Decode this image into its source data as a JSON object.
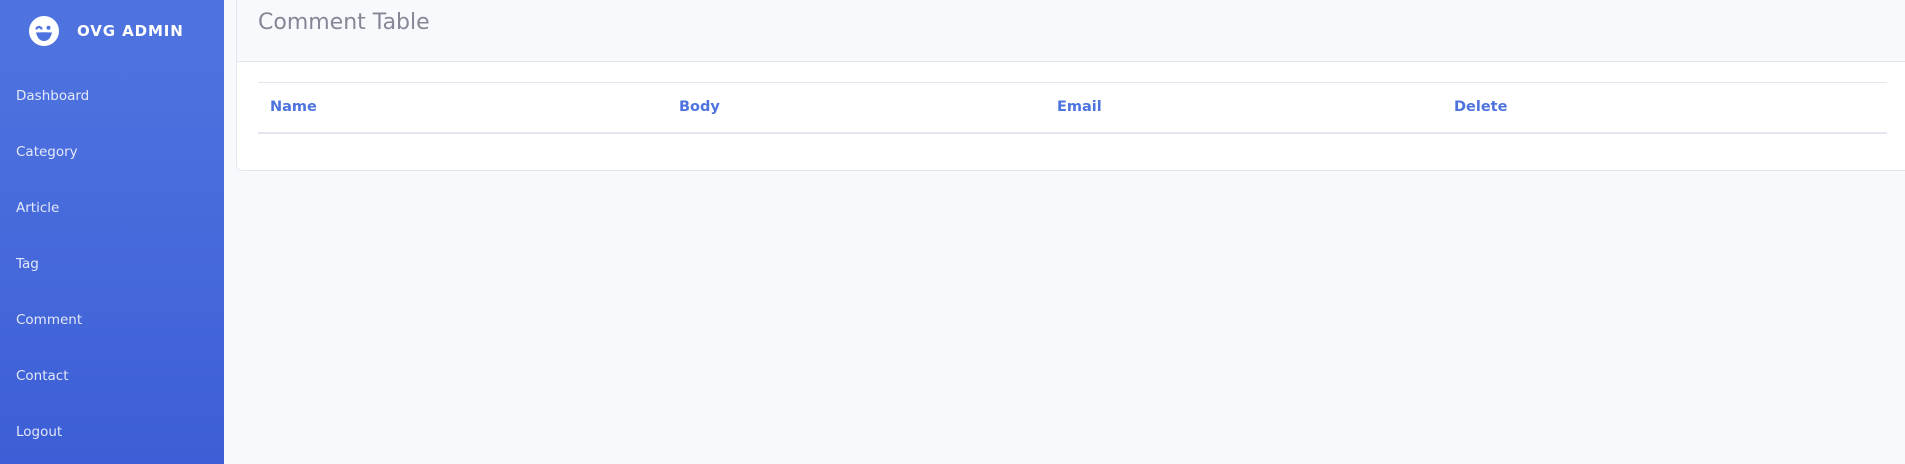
{
  "sidebar": {
    "brand": {
      "icon": "laugh-wink-icon",
      "title": "OVG ADMIN"
    },
    "items": [
      {
        "label": "Dashboard"
      },
      {
        "label": "Category"
      },
      {
        "label": "Article"
      },
      {
        "label": "Tag"
      },
      {
        "label": "Comment"
      },
      {
        "label": "Contact"
      },
      {
        "label": "Logout"
      }
    ]
  },
  "main": {
    "title": "Comment Table",
    "table": {
      "columns": [
        "Name",
        "Body",
        "Email",
        "Delete"
      ],
      "rows": []
    }
  },
  "colors": {
    "primary": "#4e73df",
    "sidebar_bottom": "#3d5ed6",
    "title_gray": "#858796",
    "border": "#e3e6f0",
    "background": "#f8f9fc"
  }
}
